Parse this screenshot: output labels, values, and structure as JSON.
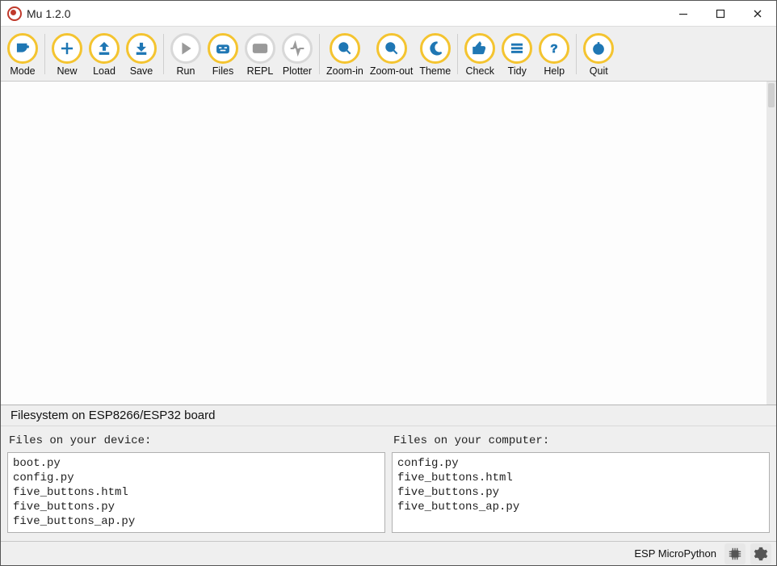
{
  "window": {
    "title": "Mu 1.2.0"
  },
  "toolbar": {
    "groups": [
      {
        "items": [
          {
            "key": "mode",
            "label": "Mode",
            "iconKey": "mode",
            "active": true
          }
        ]
      },
      {
        "items": [
          {
            "key": "new",
            "label": "New",
            "iconKey": "plus",
            "active": true
          },
          {
            "key": "load",
            "label": "Load",
            "iconKey": "upload",
            "active": true
          },
          {
            "key": "save",
            "label": "Save",
            "iconKey": "download",
            "active": true
          }
        ]
      },
      {
        "items": [
          {
            "key": "run",
            "label": "Run",
            "iconKey": "play",
            "active": false
          },
          {
            "key": "files",
            "label": "Files",
            "iconKey": "files",
            "active": true
          },
          {
            "key": "repl",
            "label": "REPL",
            "iconKey": "keyboard",
            "active": false
          },
          {
            "key": "plotter",
            "label": "Plotter",
            "iconKey": "pulse",
            "active": false
          }
        ]
      },
      {
        "items": [
          {
            "key": "zoom-in",
            "label": "Zoom-in",
            "iconKey": "zoom-in",
            "active": true
          },
          {
            "key": "zoom-out",
            "label": "Zoom-out",
            "iconKey": "zoom-out",
            "active": true
          },
          {
            "key": "theme",
            "label": "Theme",
            "iconKey": "moon",
            "active": true
          }
        ]
      },
      {
        "items": [
          {
            "key": "check",
            "label": "Check",
            "iconKey": "thumb",
            "active": true
          },
          {
            "key": "tidy",
            "label": "Tidy",
            "iconKey": "lines",
            "active": true
          },
          {
            "key": "help",
            "label": "Help",
            "iconKey": "help",
            "active": true
          }
        ]
      },
      {
        "items": [
          {
            "key": "quit",
            "label": "Quit",
            "iconKey": "power",
            "active": true
          }
        ]
      }
    ]
  },
  "filesystem": {
    "title": "Filesystem on ESP8266/ESP32 board",
    "device": {
      "header": "Files on your device:",
      "files": [
        "boot.py",
        "config.py",
        "five_buttons.html",
        "five_buttons.py",
        "five_buttons_ap.py"
      ]
    },
    "computer": {
      "header": "Files on your computer:",
      "files": [
        "config.py",
        "five_buttons.html",
        "five_buttons.py",
        "five_buttons_ap.py"
      ]
    }
  },
  "status": {
    "mode": "ESP MicroPython"
  }
}
